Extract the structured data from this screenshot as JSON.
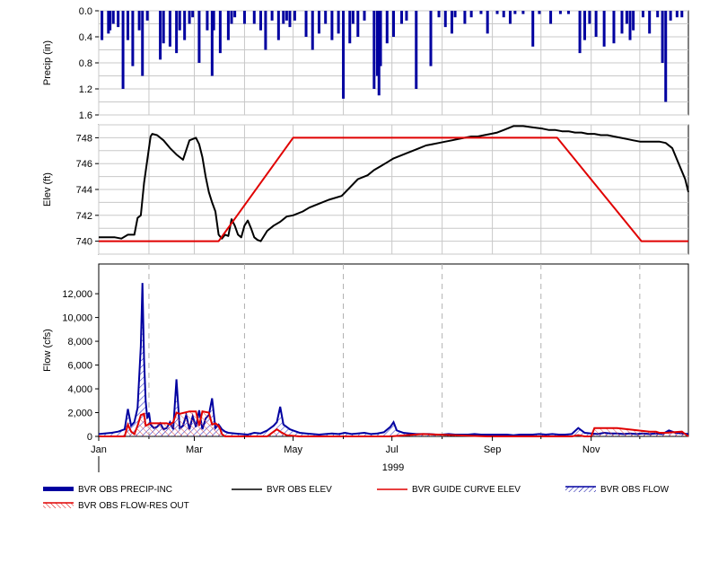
{
  "chart_data": [
    {
      "type": "bar",
      "panel": "precip",
      "ylabel": "Precip (in)",
      "ylim": [
        0.0,
        1.6
      ],
      "y_inverted": true,
      "yticks": [
        "0.0",
        "0.4",
        "0.8",
        "1.2",
        "1.6"
      ],
      "series": [
        {
          "name": "BVR OBS PRECIP-INC",
          "color": "#0000a0",
          "x_day": [
            2,
            6,
            7,
            9,
            12,
            15,
            18,
            21,
            25,
            27,
            30,
            38,
            40,
            44,
            48,
            50,
            53,
            56,
            58,
            62,
            67,
            70,
            71,
            75,
            80,
            82,
            84,
            90,
            96,
            100,
            103,
            107,
            111,
            114,
            116,
            118,
            121,
            128,
            132,
            136,
            140,
            144,
            148,
            151,
            155,
            157,
            160,
            164,
            170,
            172,
            173,
            174,
            178,
            182,
            187,
            190,
            196,
            205,
            210,
            214,
            218,
            220,
            226,
            230,
            236,
            240,
            246,
            250,
            254,
            257,
            262,
            268,
            272,
            279,
            285,
            290,
            297,
            300,
            303,
            307,
            312,
            318,
            323,
            326,
            328,
            330,
            336,
            340,
            345,
            348,
            350,
            353,
            357,
            360
          ],
          "values": [
            0.45,
            0.35,
            0.3,
            0.2,
            0.25,
            1.2,
            0.45,
            0.85,
            0.3,
            1.0,
            0.15,
            0.75,
            0.5,
            0.55,
            0.65,
            0.3,
            0.45,
            0.2,
            0.1,
            0.8,
            0.3,
            1.0,
            0.3,
            0.65,
            0.45,
            0.2,
            0.1,
            0.2,
            0.2,
            0.3,
            0.6,
            0.15,
            0.45,
            0.2,
            0.15,
            0.25,
            0.15,
            0.4,
            0.6,
            0.35,
            0.2,
            0.45,
            0.35,
            1.35,
            0.5,
            0.2,
            0.4,
            0.15,
            1.2,
            1.0,
            1.3,
            0.85,
            0.5,
            0.4,
            0.2,
            0.15,
            1.2,
            0.85,
            0.1,
            0.25,
            0.35,
            0.1,
            0.2,
            0.1,
            0.05,
            0.35,
            0.05,
            0.1,
            0.2,
            0.05,
            0.05,
            0.55,
            0.05,
            0.2,
            0.05,
            0.05,
            0.65,
            0.45,
            0.2,
            0.4,
            0.55,
            0.5,
            0.35,
            0.2,
            0.45,
            0.3,
            0.1,
            0.35,
            0.1,
            0.8,
            1.4,
            0.15,
            0.1,
            0.1
          ]
        }
      ]
    },
    {
      "type": "line",
      "panel": "elev",
      "ylabel": "Elev (ft)",
      "ylim": [
        739.0,
        749.0
      ],
      "yticks": [
        "740",
        "742",
        "744",
        "746",
        "748"
      ],
      "series": [
        {
          "name": "BVR OBS ELEV",
          "color": "#000000",
          "x_day": [
            0,
            10,
            14,
            18,
            22,
            24,
            26,
            28,
            32,
            33,
            36,
            40,
            44,
            48,
            52,
            56,
            60,
            62,
            64,
            66,
            68,
            70,
            72,
            73,
            74,
            76,
            78,
            80,
            82,
            84,
            86,
            88,
            90,
            92,
            94,
            96,
            98,
            100,
            104,
            108,
            112,
            116,
            120,
            126,
            130,
            136,
            142,
            150,
            160,
            166,
            170,
            174,
            178,
            182,
            186,
            190,
            194,
            198,
            202,
            206,
            210,
            214,
            218,
            222,
            226,
            230,
            234,
            238,
            242,
            246,
            250,
            256,
            262,
            268,
            274,
            278,
            282,
            286,
            290,
            294,
            298,
            302,
            306,
            310,
            314,
            318,
            322,
            326,
            330,
            334,
            338,
            342,
            346,
            350,
            354,
            358,
            362,
            364
          ],
          "values": [
            740.3,
            740.3,
            740.2,
            740.5,
            740.5,
            741.8,
            742.0,
            744.5,
            748.1,
            748.3,
            748.2,
            747.8,
            747.2,
            746.7,
            746.3,
            747.8,
            748.0,
            747.5,
            746.5,
            745.0,
            743.8,
            743.0,
            742.3,
            741.4,
            740.5,
            740.2,
            740.5,
            740.4,
            741.7,
            741.2,
            740.5,
            740.3,
            741.2,
            741.6,
            741.0,
            740.3,
            740.1,
            740.0,
            740.8,
            741.2,
            741.5,
            741.9,
            742.0,
            742.3,
            742.6,
            742.9,
            743.2,
            743.5,
            744.8,
            745.1,
            745.5,
            745.8,
            746.1,
            746.4,
            746.6,
            746.8,
            747.0,
            747.2,
            747.4,
            747.5,
            747.6,
            747.7,
            747.8,
            747.9,
            748.0,
            748.1,
            748.1,
            748.2,
            748.3,
            748.4,
            748.6,
            748.9,
            748.9,
            748.8,
            748.7,
            748.6,
            748.6,
            748.5,
            748.5,
            748.4,
            748.4,
            748.3,
            748.3,
            748.2,
            748.2,
            748.1,
            748.0,
            747.9,
            747.8,
            747.7,
            747.7,
            747.7,
            747.7,
            747.6,
            747.2,
            746.0,
            744.8,
            743.8
          ],
          "values_tail_note": ""
        },
        {
          "name": "BVR GUIDE CURVE ELEV",
          "color": "#e00000",
          "x_day": [
            0,
            74,
            120,
            283,
            335,
            364
          ],
          "values": [
            740.0,
            740.0,
            748.0,
            748.0,
            740.0,
            740.0
          ]
        }
      ]
    },
    {
      "type": "area",
      "panel": "flow",
      "ylabel": "Flow (cfs)",
      "ylim": [
        0,
        14500
      ],
      "yticks": [
        "0",
        "2,000",
        "4,000",
        "6,000",
        "8,000",
        "10,000",
        "12,000"
      ],
      "xlabel": "1999",
      "xticks": [
        "Jan",
        "Mar",
        "May",
        "Jul",
        "Sep",
        "Nov"
      ],
      "xtick_days": [
        0,
        59,
        120,
        181,
        243,
        304
      ],
      "series": [
        {
          "name": "BVR OBS FLOW",
          "color": "#0000a0",
          "x_day": [
            0,
            8,
            12,
            16,
            18,
            20,
            22,
            24,
            26,
            27,
            28,
            29,
            30,
            31,
            32,
            34,
            36,
            38,
            40,
            42,
            44,
            46,
            48,
            50,
            52,
            54,
            56,
            58,
            60,
            62,
            64,
            66,
            68,
            70,
            72,
            74,
            76,
            78,
            80,
            84,
            88,
            92,
            96,
            100,
            104,
            108,
            110,
            112,
            114,
            116,
            118,
            120,
            124,
            128,
            132,
            136,
            140,
            144,
            148,
            152,
            156,
            160,
            164,
            168,
            172,
            176,
            180,
            182,
            184,
            188,
            192,
            196,
            200,
            204,
            208,
            212,
            216,
            220,
            224,
            228,
            232,
            236,
            240,
            244,
            248,
            252,
            256,
            260,
            264,
            268,
            272,
            276,
            280,
            284,
            288,
            292,
            296,
            300,
            304,
            308,
            312,
            316,
            320,
            324,
            328,
            332,
            336,
            340,
            344,
            348,
            352,
            356,
            360,
            364
          ],
          "values": [
            200,
            300,
            400,
            600,
            2300,
            900,
            1200,
            2400,
            7600,
            12900,
            6500,
            3000,
            1500,
            2000,
            1000,
            700,
            800,
            1100,
            600,
            700,
            1200,
            600,
            4800,
            700,
            900,
            1800,
            600,
            1700,
            800,
            2200,
            600,
            1500,
            1800,
            3200,
            700,
            1000,
            600,
            400,
            300,
            250,
            200,
            150,
            300,
            250,
            500,
            900,
            1200,
            2500,
            1000,
            800,
            600,
            500,
            300,
            250,
            200,
            150,
            200,
            250,
            200,
            300,
            200,
            250,
            300,
            200,
            250,
            350,
            800,
            1200,
            500,
            300,
            250,
            200,
            200,
            200,
            150,
            150,
            200,
            150,
            150,
            150,
            200,
            150,
            150,
            150,
            150,
            150,
            100,
            150,
            150,
            150,
            200,
            150,
            200,
            150,
            150,
            200,
            700,
            300,
            250,
            200,
            300,
            250,
            250,
            200,
            250,
            200,
            250,
            200,
            250,
            200,
            500,
            300,
            250,
            200
          ]
        },
        {
          "name": "BVR OBS FLOW-RES OUT",
          "color": "#e00000",
          "x_day": [
            0,
            16,
            18,
            20,
            22,
            24,
            26,
            28,
            29,
            32,
            38,
            42,
            44,
            46,
            48,
            50,
            56,
            60,
            62,
            64,
            68,
            70,
            72,
            74,
            75,
            76,
            78,
            80,
            104,
            108,
            110,
            112,
            116,
            124,
            180,
            200,
            240,
            288,
            290,
            292,
            296,
            300,
            302,
            304,
            306,
            310,
            320,
            340,
            344,
            346,
            350,
            360,
            364
          ],
          "values": [
            0,
            0,
            1000,
            400,
            200,
            900,
            1800,
            1900,
            900,
            1100,
            1100,
            1100,
            1000,
            1200,
            2000,
            1900,
            2100,
            2100,
            900,
            2100,
            2000,
            1000,
            1100,
            900,
            600,
            200,
            0,
            0,
            0,
            400,
            600,
            400,
            100,
            0,
            0,
            200,
            0,
            0,
            0,
            0,
            100,
            0,
            0,
            0,
            700,
            700,
            700,
            400,
            400,
            300,
            300,
            400,
            0
          ],
          "hatched": true
        }
      ]
    }
  ],
  "legend": [
    {
      "label": "BVR OBS PRECIP-INC",
      "swatch": "thick-bar",
      "color": "#0000a0"
    },
    {
      "label": "BVR OBS ELEV",
      "swatch": "line",
      "color": "#000000"
    },
    {
      "label": "BVR GUIDE CURVE ELEV",
      "swatch": "line",
      "color": "#e00000"
    },
    {
      "label": "BVR OBS FLOW",
      "swatch": "hatch-blue",
      "color": "#0000a0"
    },
    {
      "label": "BVR OBS FLOW-RES OUT",
      "swatch": "hatch-red",
      "color": "#e00000"
    }
  ]
}
